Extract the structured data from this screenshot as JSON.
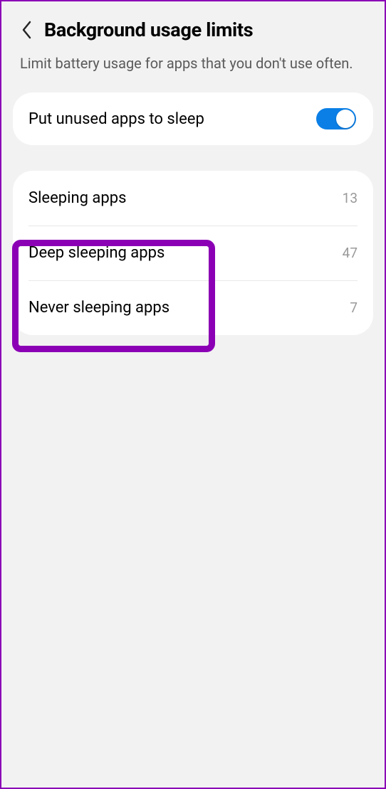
{
  "header": {
    "title": "Background usage limits",
    "description": "Limit battery usage for apps that you don't use often."
  },
  "toggle": {
    "label": "Put unused apps to sleep",
    "enabled": true
  },
  "list": [
    {
      "label": "Sleeping apps",
      "count": "13"
    },
    {
      "label": "Deep sleeping apps",
      "count": "47"
    },
    {
      "label": "Never sleeping apps",
      "count": "7"
    }
  ]
}
